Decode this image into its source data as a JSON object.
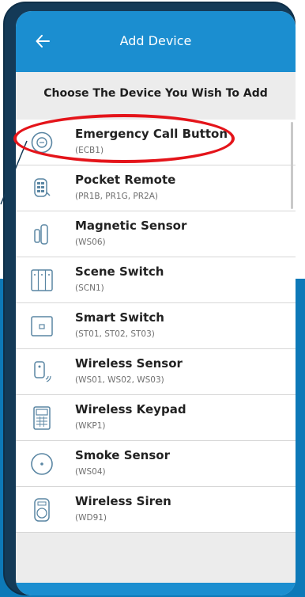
{
  "header": {
    "title": "Add Device",
    "back_icon": "arrow-left-icon"
  },
  "prompt": "Choose The Device You Wish To Add",
  "colors": {
    "header": "#1b8ed0",
    "phone_frame": "#143a57",
    "highlight": "#e4141a",
    "backdrop_bottom": "#0d79b8"
  },
  "devices": [
    {
      "name": "Emergency Call Button",
      "model": "(ECB1)",
      "icon": "emergency-button-icon"
    },
    {
      "name": "Pocket Remote",
      "model": "(PR1B, PR1G, PR2A)",
      "icon": "pocket-remote-icon"
    },
    {
      "name": "Magnetic Sensor",
      "model": "(WS06)",
      "icon": "magnetic-sensor-icon"
    },
    {
      "name": "Scene Switch",
      "model": "(SCN1)",
      "icon": "scene-switch-icon"
    },
    {
      "name": "Smart Switch",
      "model": "(ST01, ST02, ST03)",
      "icon": "smart-switch-icon"
    },
    {
      "name": "Wireless Sensor",
      "model": "(WS01, WS02, WS03)",
      "icon": "wireless-sensor-icon"
    },
    {
      "name": "Wireless Keypad",
      "model": "(WKP1)",
      "icon": "keypad-icon"
    },
    {
      "name": "Smoke Sensor",
      "model": "(WS04)",
      "icon": "smoke-sensor-icon"
    },
    {
      "name": "Wireless Siren",
      "model": "(WD91)",
      "icon": "siren-icon"
    }
  ]
}
